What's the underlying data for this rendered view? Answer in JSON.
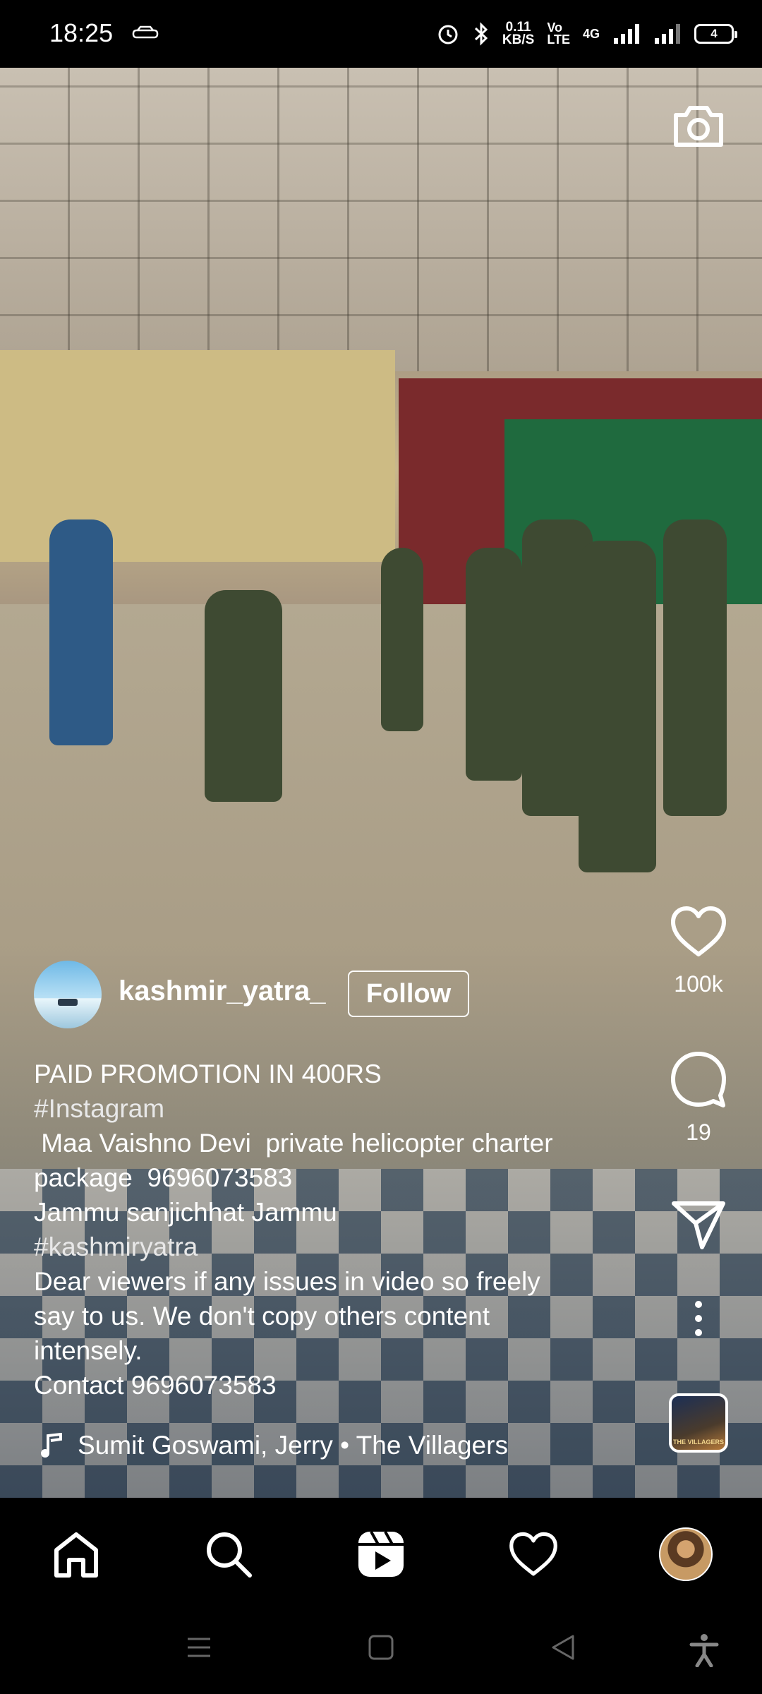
{
  "status_bar": {
    "time": "18:25",
    "net_speed": "0.11\nKB/S",
    "volte": "Vo\nLTE",
    "network": "4G",
    "battery": "4"
  },
  "post": {
    "username": "kashmir_yatra_",
    "follow_label": "Follow",
    "caption_lines": [
      "PAID PROMOTION IN 400RS",
      "#Instagram",
      " Maa Vaishno Devi  private helicopter charter",
      "package  9696073583",
      "Jammu sanjichhat Jammu",
      "#kashmiryatra",
      "Dear viewers if any issues in video so freely",
      "say to us. We don't copy others content",
      "intensely.",
      "Contact 9696073583"
    ],
    "audio": "Sumit Goswami, Jerry • The Villagers",
    "audio_thumb_text": "THE VILLAGERS"
  },
  "actions": {
    "likes": "100k",
    "comments": "19"
  },
  "icons": {
    "camera": "camera-icon",
    "like": "heart-icon",
    "comment": "comment-icon",
    "share": "send-icon",
    "more": "more-icon",
    "music": "music-note-icon"
  },
  "nav": {
    "items": [
      "home-icon",
      "search-icon",
      "reels-icon",
      "activity-icon",
      "profile-avatar"
    ]
  }
}
